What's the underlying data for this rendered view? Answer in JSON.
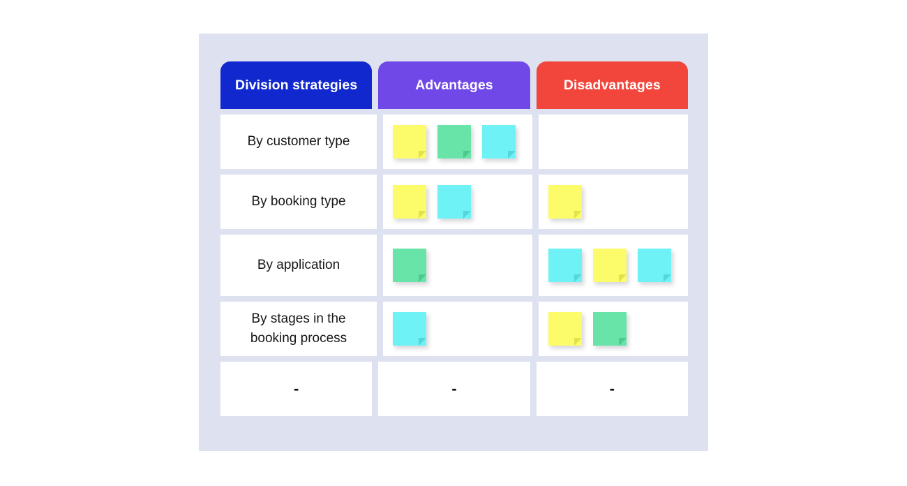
{
  "board": {
    "background_color": "#dee2f0"
  },
  "columns": [
    {
      "label": "Division strategies",
      "color": "#1128cf"
    },
    {
      "label": "Advantages",
      "color": "#7048e8"
    },
    {
      "label": "Disadvantages",
      "color": "#f2463c"
    }
  ],
  "note_colors": {
    "yellow": "#fcfc6a",
    "green": "#68e4a8",
    "cyan": "#6ef2f5"
  },
  "rows": [
    {
      "label": "By customer type",
      "advantages_notes": [
        "yellow",
        "green",
        "cyan"
      ],
      "disadvantages_notes": []
    },
    {
      "label": "By booking type",
      "advantages_notes": [
        "yellow",
        "cyan"
      ],
      "disadvantages_notes": [
        "yellow"
      ]
    },
    {
      "label": "By application",
      "advantages_notes": [
        "green"
      ],
      "disadvantages_notes": [
        "cyan",
        "yellow",
        "cyan"
      ]
    },
    {
      "label": "By stages in the booking process",
      "advantages_notes": [
        "cyan"
      ],
      "disadvantages_notes": [
        "yellow",
        "green"
      ]
    },
    {
      "label": "-",
      "advantages_label": "-",
      "disadvantages_label": "-"
    }
  ]
}
